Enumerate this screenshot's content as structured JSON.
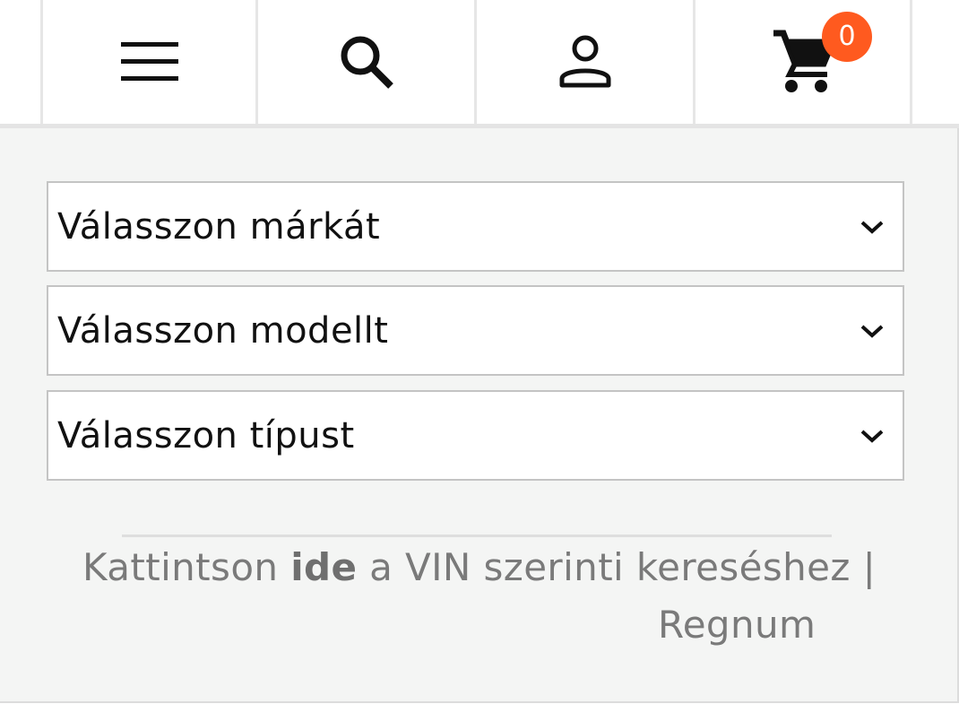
{
  "header": {
    "menu_icon": "hamburger-menu-icon",
    "search_icon": "search-icon",
    "account_icon": "user-icon",
    "cart_icon": "shopping-cart-icon",
    "cart_count": "0",
    "badge_color": "#ff5a1f"
  },
  "filters": {
    "brand_select": "Válasszon márkát",
    "model_select": "Válasszon modellt",
    "type_select": "Válasszon típust"
  },
  "vin_search": {
    "prefix": "Kattintson ",
    "link_text": "ide",
    "suffix": " a VIN szerinti kereséshez |",
    "line2": "Regnum"
  },
  "colors": {
    "panel_background": "#f4f5f4",
    "text_muted": "#7a7a7a"
  }
}
